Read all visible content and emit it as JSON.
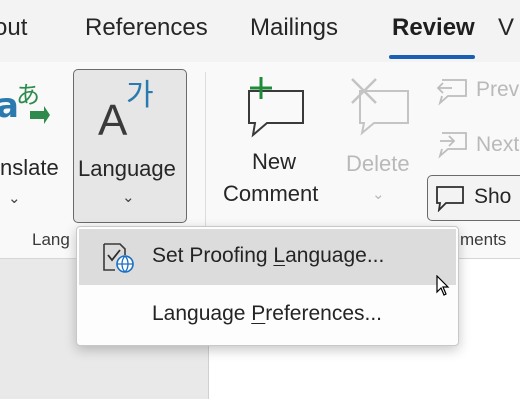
{
  "tabs": {
    "items": [
      {
        "label": "out"
      },
      {
        "label": "References"
      },
      {
        "label": "Mailings"
      },
      {
        "label": "Review",
        "active": true
      },
      {
        "label": "V"
      }
    ]
  },
  "ribbon": {
    "translate": {
      "label": "nslate"
    },
    "language": {
      "label": "Language",
      "icon_text": "가"
    },
    "new_comment": {
      "line1": "New",
      "line2": "Comment"
    },
    "delete": {
      "label": "Delete"
    },
    "previous": {
      "label": "Prev"
    },
    "next": {
      "label": "Next"
    },
    "show": {
      "label": "Sho"
    },
    "groups": {
      "language_label": "Lang",
      "comments_label": "ments"
    }
  },
  "menu": {
    "items": [
      {
        "pre": "Set Proofing ",
        "key": "L",
        "post": "anguage..."
      },
      {
        "pre": "Language ",
        "key": "P",
        "post": "references..."
      }
    ]
  },
  "colors": {
    "accent": "#1a5fb4",
    "new_comment_plus": "#1e8a3a",
    "translate_blue": "#2a7ab0",
    "translate_green": "#2f8a4d"
  }
}
